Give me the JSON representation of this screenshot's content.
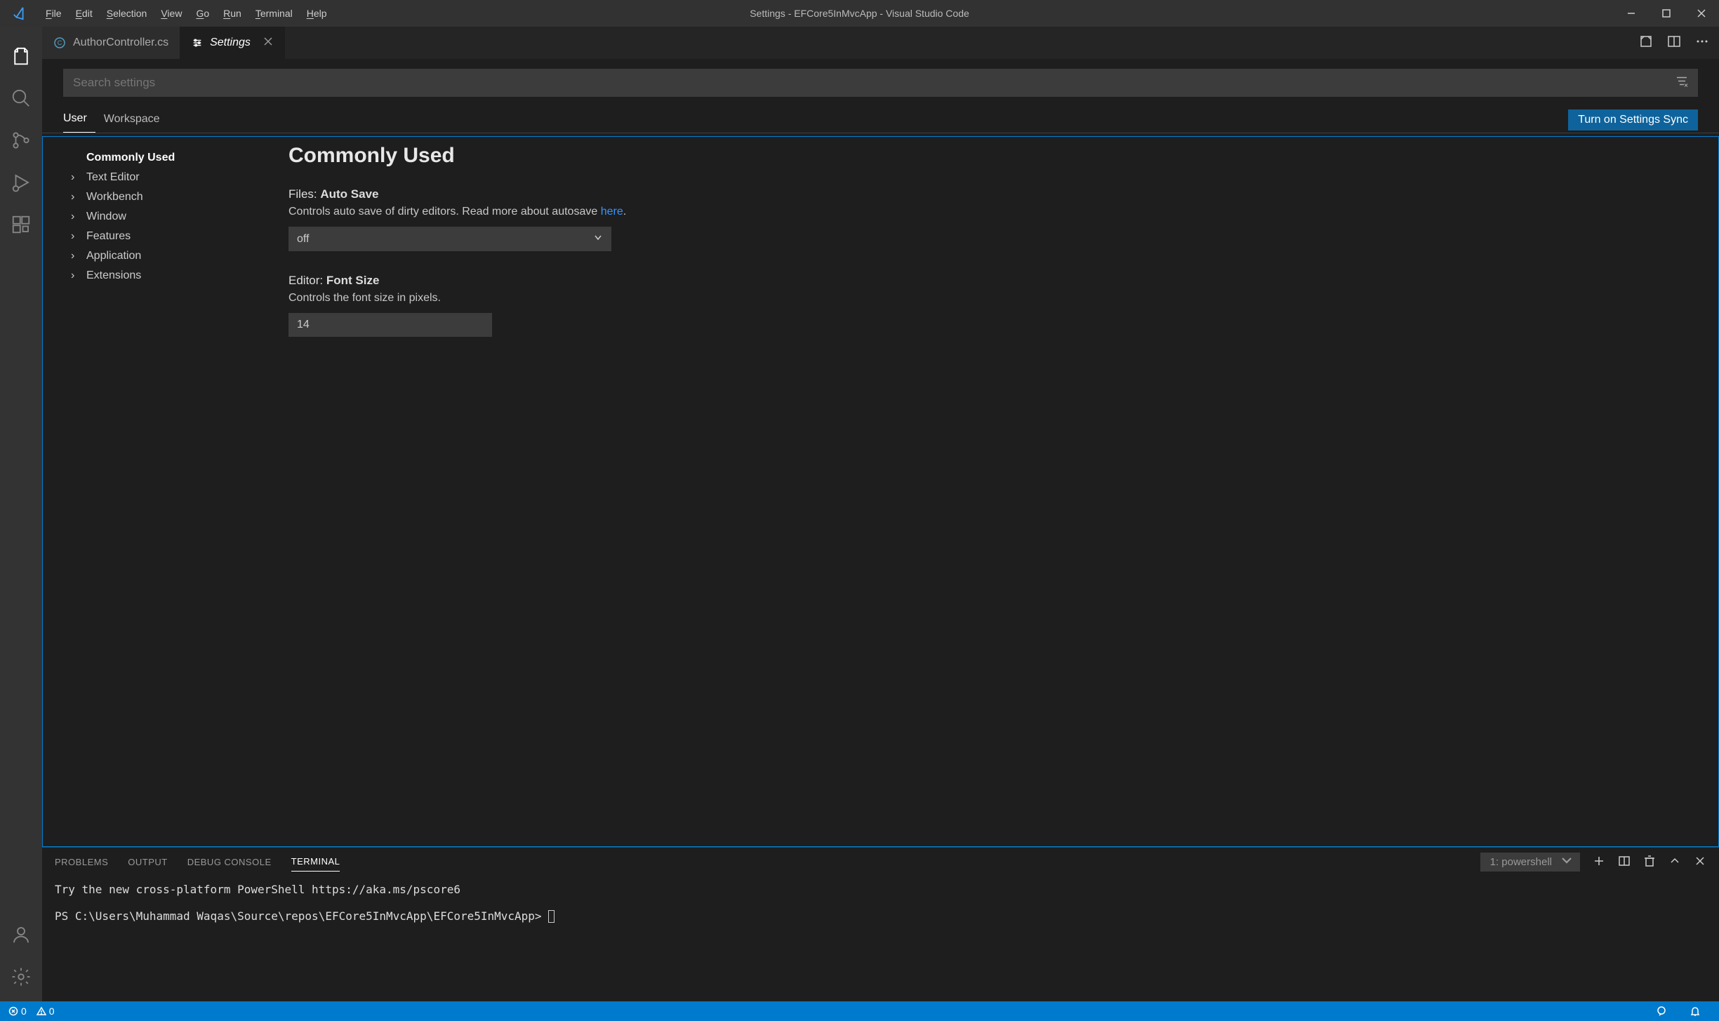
{
  "window": {
    "title": "Settings - EFCore5InMvcApp - Visual Studio Code"
  },
  "menus": [
    "File",
    "Edit",
    "Selection",
    "View",
    "Go",
    "Run",
    "Terminal",
    "Help"
  ],
  "tabs": {
    "items": [
      {
        "label": "AuthorController.cs",
        "active": false
      },
      {
        "label": "Settings",
        "active": true
      }
    ]
  },
  "search": {
    "placeholder": "Search settings"
  },
  "scopes": {
    "user": "User",
    "workspace": "Workspace",
    "sync_button": "Turn on Settings Sync"
  },
  "toc": [
    {
      "label": "Commonly Used",
      "selected": true
    },
    {
      "label": "Text Editor",
      "selected": false
    },
    {
      "label": "Workbench",
      "selected": false
    },
    {
      "label": "Window",
      "selected": false
    },
    {
      "label": "Features",
      "selected": false
    },
    {
      "label": "Application",
      "selected": false
    },
    {
      "label": "Extensions",
      "selected": false
    }
  ],
  "content": {
    "heading": "Commonly Used",
    "autosave": {
      "cat": "Files: ",
      "name": "Auto Save",
      "desc1": "Controls auto save of dirty editors. Read more about autosave ",
      "link": "here",
      "desc2": ".",
      "value": "off"
    },
    "fontsize": {
      "cat": "Editor: ",
      "name": "Font Size",
      "desc": "Controls the font size in pixels.",
      "value": "14"
    }
  },
  "panel": {
    "tabs": [
      "PROBLEMS",
      "OUTPUT",
      "DEBUG CONSOLE",
      "TERMINAL"
    ],
    "active_idx": 3,
    "term_select": "1: powershell",
    "terminal_line1": "Try the new cross-platform PowerShell https://aka.ms/pscore6",
    "terminal_line2": "PS C:\\Users\\Muhammad Waqas\\Source\\repos\\EFCore5InMvcApp\\EFCore5InMvcApp> "
  },
  "statusbar": {
    "errors": "0",
    "warnings": "0"
  }
}
